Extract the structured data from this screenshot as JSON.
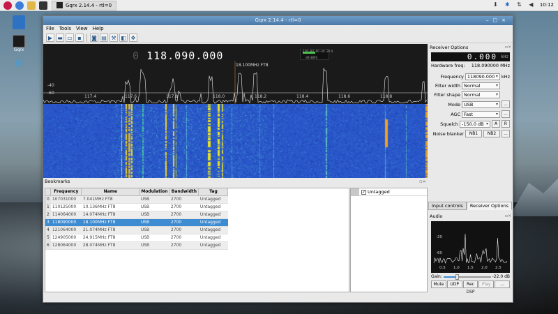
{
  "desktop": {
    "icons": [
      {
        "label": ""
      },
      {
        "label": "Gqrx"
      },
      {
        "label": ""
      }
    ]
  },
  "panel": {
    "task_label": "Gqrx 2.14.4 - rtl=0",
    "clock": "10:12"
  },
  "window": {
    "title": "Gqrx 2.14.4 - rtl=0"
  },
  "menu": [
    "File",
    "Tools",
    "View",
    "Help"
  ],
  "spectrum": {
    "freq_dim": "0",
    "freq_main": "118.090.000",
    "cursor_label": "18.100MHz FT8",
    "levels": [
      "-40",
      "-60"
    ],
    "meter_ticks": "-100 -80 -60 -40 -20 0",
    "meter_db": "-49 dBFS",
    "x_ticks": [
      "117.4",
      "117.6",
      "117.8",
      "118.0",
      "118.2",
      "118.4",
      "118.6",
      "118.8"
    ]
  },
  "bookmarks": {
    "title": "Bookmarks",
    "columns": [
      "Frequency",
      "Name",
      "Modulation",
      "Bandwidth",
      "Tag"
    ],
    "rows": [
      {
        "idx": "0",
        "freq": "107031000",
        "name": "7.041MHz FT8",
        "mod": "USB",
        "bw": "2700",
        "tag": "Untagged"
      },
      {
        "idx": "1",
        "freq": "110125000",
        "name": "10.136MHz FT8",
        "mod": "USB",
        "bw": "2700",
        "tag": "Untagged"
      },
      {
        "idx": "2",
        "freq": "114064000",
        "name": "14.074MHz FT8",
        "mod": "USB",
        "bw": "2700",
        "tag": "Untagged"
      },
      {
        "idx": "3",
        "freq": "118090000",
        "name": "18.100MHz FT8",
        "mod": "USB",
        "bw": "2700",
        "tag": "Untagged"
      },
      {
        "idx": "4",
        "freq": "121064000",
        "name": "21.074MHz FT8",
        "mod": "USB",
        "bw": "2700",
        "tag": "Untagged"
      },
      {
        "idx": "5",
        "freq": "124905000",
        "name": "24.915MHz FT8",
        "mod": "USB",
        "bw": "2700",
        "tag": "Untagged"
      },
      {
        "idx": "6",
        "freq": "128064000",
        "name": "28.074MHz FT8",
        "mod": "USB",
        "bw": "2700",
        "tag": "Untagged"
      }
    ],
    "selected_index": 3,
    "tag_panel_item": "Untagged"
  },
  "receiver": {
    "title": "Receiver Options",
    "offset_display": "0.000",
    "offset_unit": "kHz",
    "hw_label": "Hardware freq:",
    "hw_value": "118.090000 MHz",
    "frequency_label": "Frequency",
    "frequency_value": "118090.000",
    "frequency_unit": "kHz",
    "filter_width_label": "Filter width",
    "filter_width_value": "Normal",
    "filter_shape_label": "Filter shape",
    "filter_shape_value": "Normal",
    "mode_label": "Mode",
    "mode_value": "USB",
    "agc_label": "AGC",
    "agc_value": "Fast",
    "squelch_label": "Squelch",
    "squelch_value": "-150.0 dB",
    "squelch_a": "A",
    "squelch_r": "R",
    "nb_label": "Noise blanker",
    "nb1": "NB1",
    "nb2": "NB2",
    "more": "..."
  },
  "tabs": [
    "Input controls",
    "Receiver Options"
  ],
  "audio": {
    "title": "Audio",
    "ylabels": [
      "-20",
      "-60"
    ],
    "xlabels": [
      "0.5",
      "1.0",
      "1.5",
      "2.0",
      "2.5"
    ],
    "gain_label": "Gain:",
    "gain_value": "-22.0 dB",
    "gain_level": 0.3,
    "buttons": [
      "Mute",
      "UDP",
      "Rec",
      "Play",
      "..."
    ],
    "dsp": "DSP"
  }
}
